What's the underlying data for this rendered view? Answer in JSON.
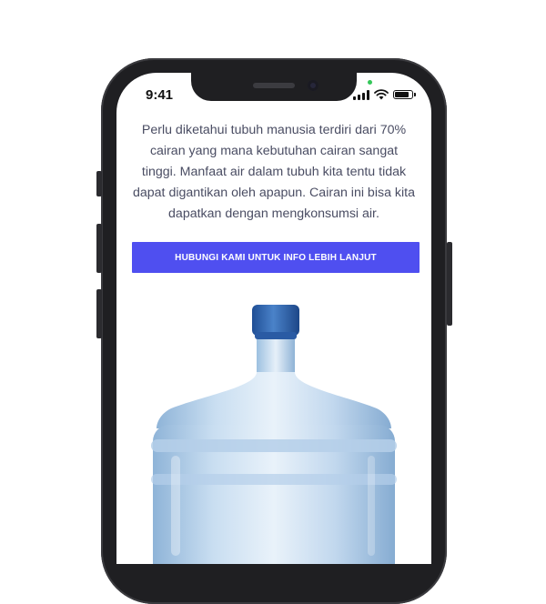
{
  "status_bar": {
    "time": "9:41",
    "icons": [
      "cellular-signal-icon",
      "wifi-icon",
      "battery-icon"
    ],
    "battery_level": 0.9
  },
  "content": {
    "description": "Perlu diketahui tubuh manusia terdiri dari 70% cairan yang mana kebutuhan cairan sangat tinggi. Manfaat air dalam tubuh kita tentu tidak dapat digantikan oleh apapun. Cairan ini bisa kita dapatkan dengan mengkonsumsi air.",
    "cta_label": "HUBUNGI KAMI UNTUK INFO LEBIH LANJUT"
  },
  "colors": {
    "accent": "#4f4ff0",
    "text": "#4a4d63",
    "cap": "#2d5fae",
    "bottle": "#a9c8e6"
  }
}
